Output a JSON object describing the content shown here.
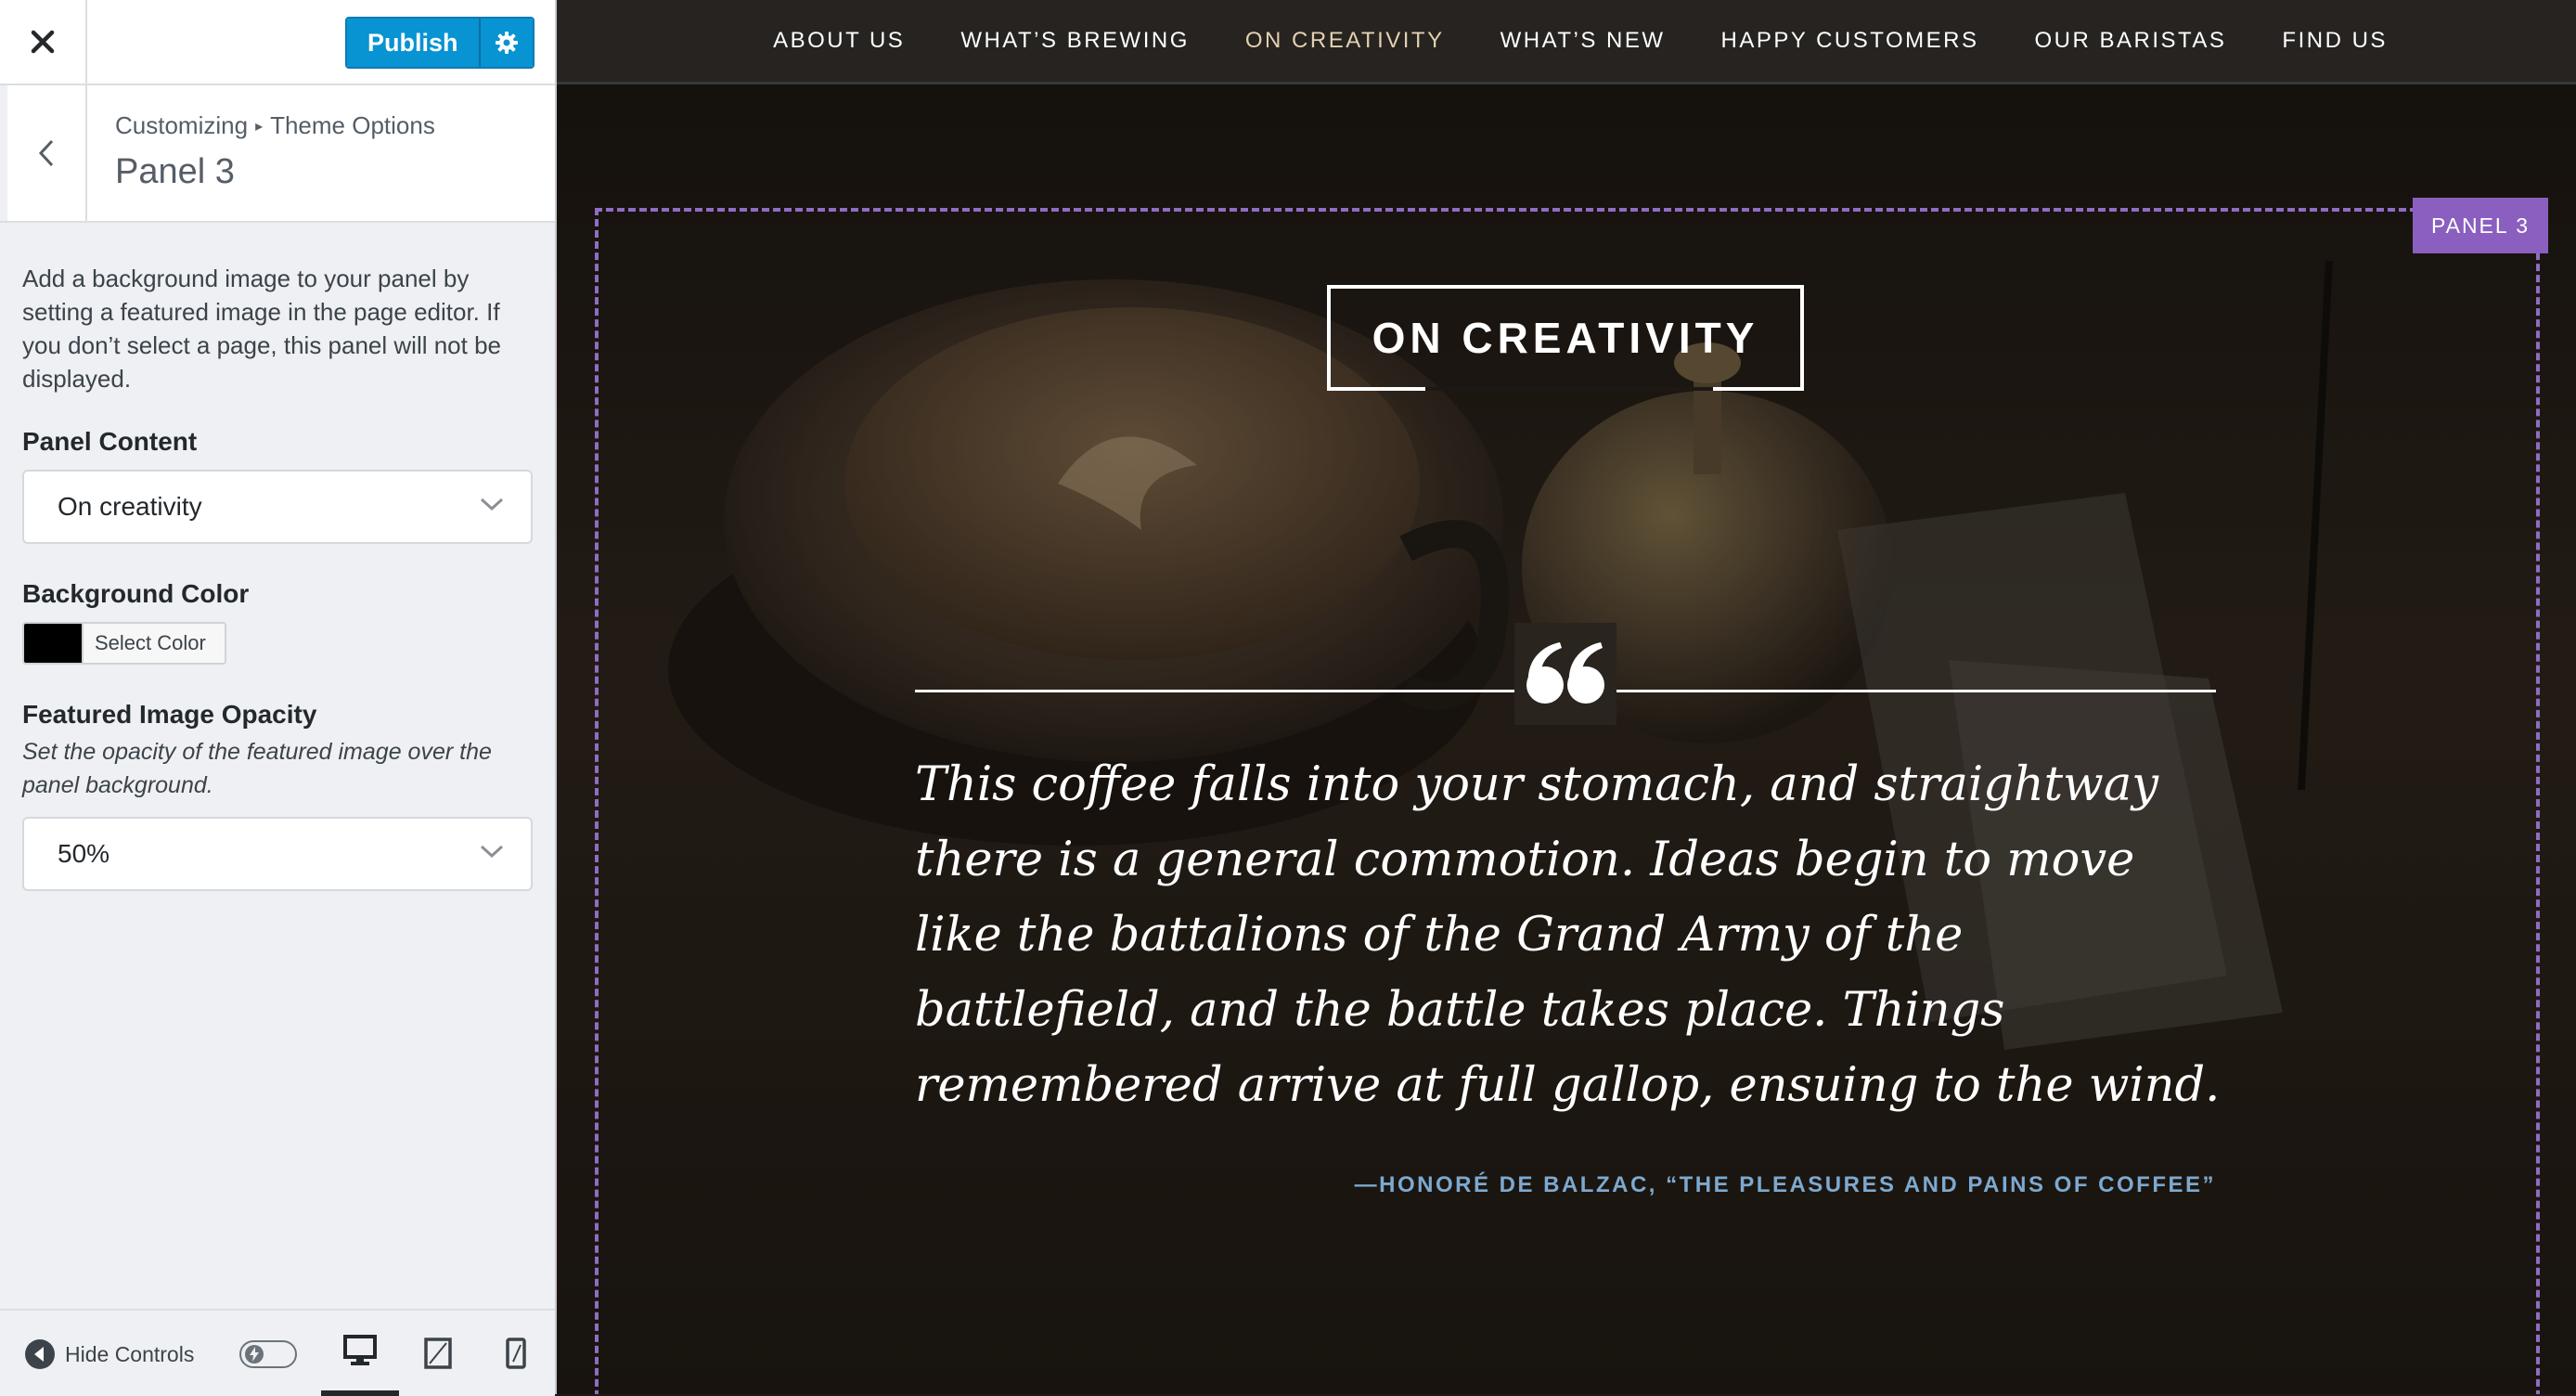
{
  "customizer": {
    "publish_label": "Publish",
    "breadcrumb": {
      "root": "Customizing",
      "separator": "▸",
      "parent": "Theme Options"
    },
    "section_title": "Panel 3",
    "description": "Add a background image to your panel by setting a featured image in the page editor. If you don’t select a page, this panel will not be displayed.",
    "panel_content": {
      "label": "Panel Content",
      "value": "On creativity"
    },
    "background_color": {
      "label": "Background Color",
      "button_label": "Select Color",
      "value": "#000000"
    },
    "featured_image_opacity": {
      "label": "Featured Image Opacity",
      "description": "Set the opacity of the featured image over the panel background.",
      "value": "50%"
    },
    "footer": {
      "hide_controls_label": "Hide Controls",
      "active_device": "desktop"
    }
  },
  "preview": {
    "nav": [
      {
        "label": "ABOUT US",
        "active": false
      },
      {
        "label": "WHAT’S BREWING",
        "active": false
      },
      {
        "label": "ON CREATIVITY",
        "active": true
      },
      {
        "label": "WHAT’S NEW",
        "active": false
      },
      {
        "label": "HAPPY CUSTOMERS",
        "active": false
      },
      {
        "label": "OUR BARISTAS",
        "active": false
      },
      {
        "label": "FIND US",
        "active": false
      }
    ],
    "panel_badge": "PANEL 3",
    "panel_title": "ON CREATIVITY",
    "quote_mark": "“",
    "quote": "This coffee falls into your stomach, and straightway there is a general commotion. Ideas begin to move like the battalions of the Grand Army of the battlefield, and the battle takes place. Things remembered arrive at full gallop, ensuing to the wind.",
    "citation": "—HONORÉ DE BALZAC, “THE PLEASURES AND PAINS OF COFFEE”"
  },
  "colors": {
    "publish_button": "#0893d3",
    "nav_active": "#e3d1b0",
    "panel_badge": "#8a5fc0",
    "citation": "#7da9cf"
  }
}
